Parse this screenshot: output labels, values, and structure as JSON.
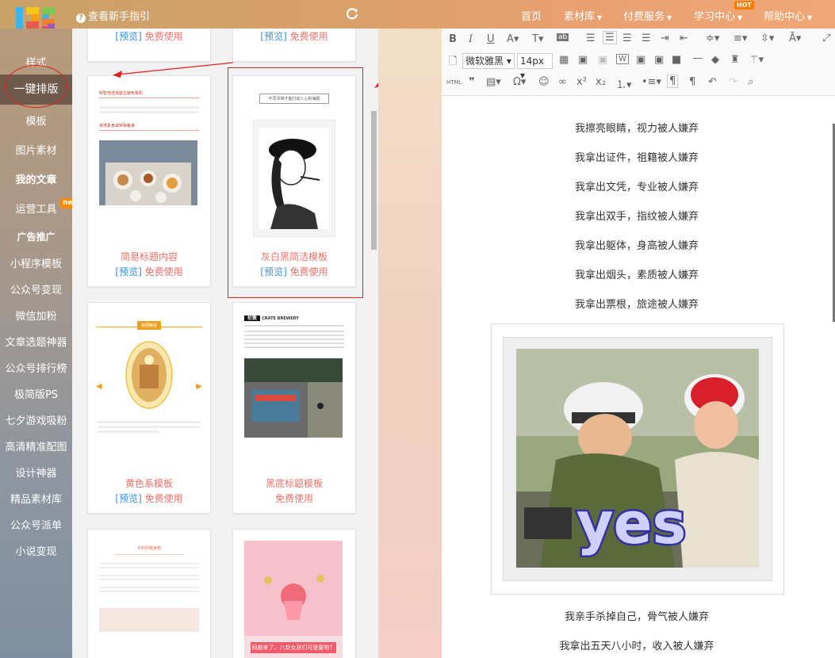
{
  "topbar": {
    "guide": "查看新手指引",
    "nav": [
      {
        "label": "首页",
        "caret": false
      },
      {
        "label": "素材库",
        "caret": true
      },
      {
        "label": "付费服务",
        "caret": true
      },
      {
        "label": "学习中心",
        "caret": true
      },
      {
        "label": "帮助中心",
        "caret": true
      }
    ],
    "hot_badge": "HOT"
  },
  "sidebar": {
    "items": [
      {
        "label": "样式"
      },
      {
        "label": "一键排版"
      },
      {
        "label": "模板"
      },
      {
        "label": "图片素材"
      },
      {
        "label": "我的文章"
      },
      {
        "label": "运营工具"
      },
      {
        "label": "广告推广"
      },
      {
        "label": "小程序模板"
      },
      {
        "label": "公众号变现"
      },
      {
        "label": "微信加粉"
      },
      {
        "label": "文章选题神器"
      },
      {
        "label": "公众号排行榜"
      },
      {
        "label": "极简版PS"
      },
      {
        "label": "七夕游戏吸粉"
      },
      {
        "label": "高清精准配图"
      },
      {
        "label": "设计神器"
      },
      {
        "label": "精品素材库"
      },
      {
        "label": "公众号派单"
      },
      {
        "label": "小说变现"
      }
    ],
    "new_badge": "new"
  },
  "templates": {
    "preview": "[预览]",
    "use": "免费使用",
    "cards": [
      {
        "title": "",
        "has_preview": true
      },
      {
        "title": "",
        "has_preview": true
      },
      {
        "title": "简易标题内容",
        "has_preview": true
      },
      {
        "title": "灰白黑简洁模板",
        "has_preview": true
      },
      {
        "title": "黄色系模板",
        "has_preview": true
      },
      {
        "title": "黑底标题模板",
        "has_preview": false
      },
      {
        "title": "",
        "has_preview": false
      },
      {
        "title": "",
        "has_preview": false
      }
    ],
    "thumb_text": {
      "t1_h1": "明智地选择座位避免晕机",
      "t1_h2": "考虑素食或特殊餐食",
      "t2_caption": "不同寻常才能打动人心的海报",
      "t3_badge": "家居精选",
      "t4_head": "伦敦",
      "t4_sub": "CRATE BREWERY",
      "t5_head": "中药护眼食物",
      "t6_caption": "同颜来了，八卦女孩们可是要啦？"
    }
  },
  "editor": {
    "font_family": "微软雅黑",
    "font_size": "14px",
    "html_label": "HTML",
    "lines_top": [
      "我擦亮眼睛，视力被人嫌弃",
      "我拿出证件，祖籍被人嫌弃",
      "我拿出文凭，专业被人嫌弃",
      "我拿出双手，指纹被人嫌弃",
      "我拿出躯体，身高被人嫌弃",
      "我拿出烟头，素质被人嫌弃",
      "我拿出票根，旅途被人嫌弃"
    ],
    "image_text": "yes",
    "lines_bottom": [
      "我亲手杀掉自己，骨气被人嫌弃",
      "我拿出五天八小时，收入被人嫌弃"
    ]
  }
}
